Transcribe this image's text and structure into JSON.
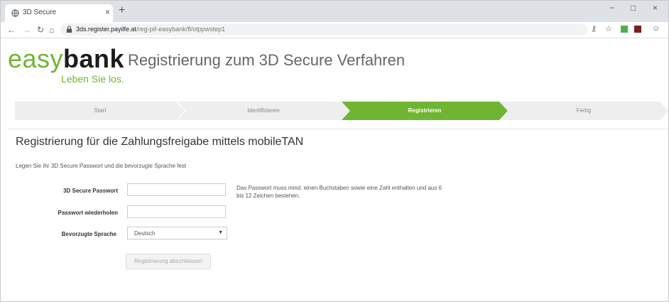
{
  "browser": {
    "tab_title": "3D Secure",
    "tab_close": "×",
    "new_tab": "+",
    "win_min": "−",
    "win_max": "□",
    "win_close": "×",
    "url_host": "3ds.register.payilfe.at",
    "url_path": "/reg-pif-easybank/fl/otppwstep1"
  },
  "logo": {
    "easy": "easy",
    "bank": "bank",
    "tagline": "Leben Sie los."
  },
  "page": {
    "heading": "Registrierung zum 3D Secure Verfahren",
    "subheading": "Registrierung für die Zahlungsfreigabe mittels mobileTAN",
    "instruction": "Legen Sie Ihr 3D Secure Passwort und die bevorzugte Sprache fest"
  },
  "stepper": {
    "steps": [
      {
        "label": "Start",
        "active": false
      },
      {
        "label": "Identifizieren",
        "active": false
      },
      {
        "label": "Registrieren",
        "active": true
      },
      {
        "label": "Fertig",
        "active": false
      }
    ],
    "active_color": "#6fb532",
    "inactive_color": "#eeeeee"
  },
  "form": {
    "password_label": "3D Secure Passwort",
    "password_value": "",
    "repeat_label": "Passwort wiederholen",
    "repeat_value": "",
    "language_label": "Bevorzugte Sprache",
    "language_value": "Deutsch",
    "hint": "Das Passwort muss mind. einen Buchstaben sowie eine Zahl enthalten und aus 6 bis 12 Zeichen bestehen.",
    "submit_label": "Registrierung abschliessen"
  },
  "icons": {
    "favicon": "globe-icon",
    "lock": "lock-icon",
    "key": "key-icon",
    "star": "star-icon",
    "menu": "account-icon"
  }
}
